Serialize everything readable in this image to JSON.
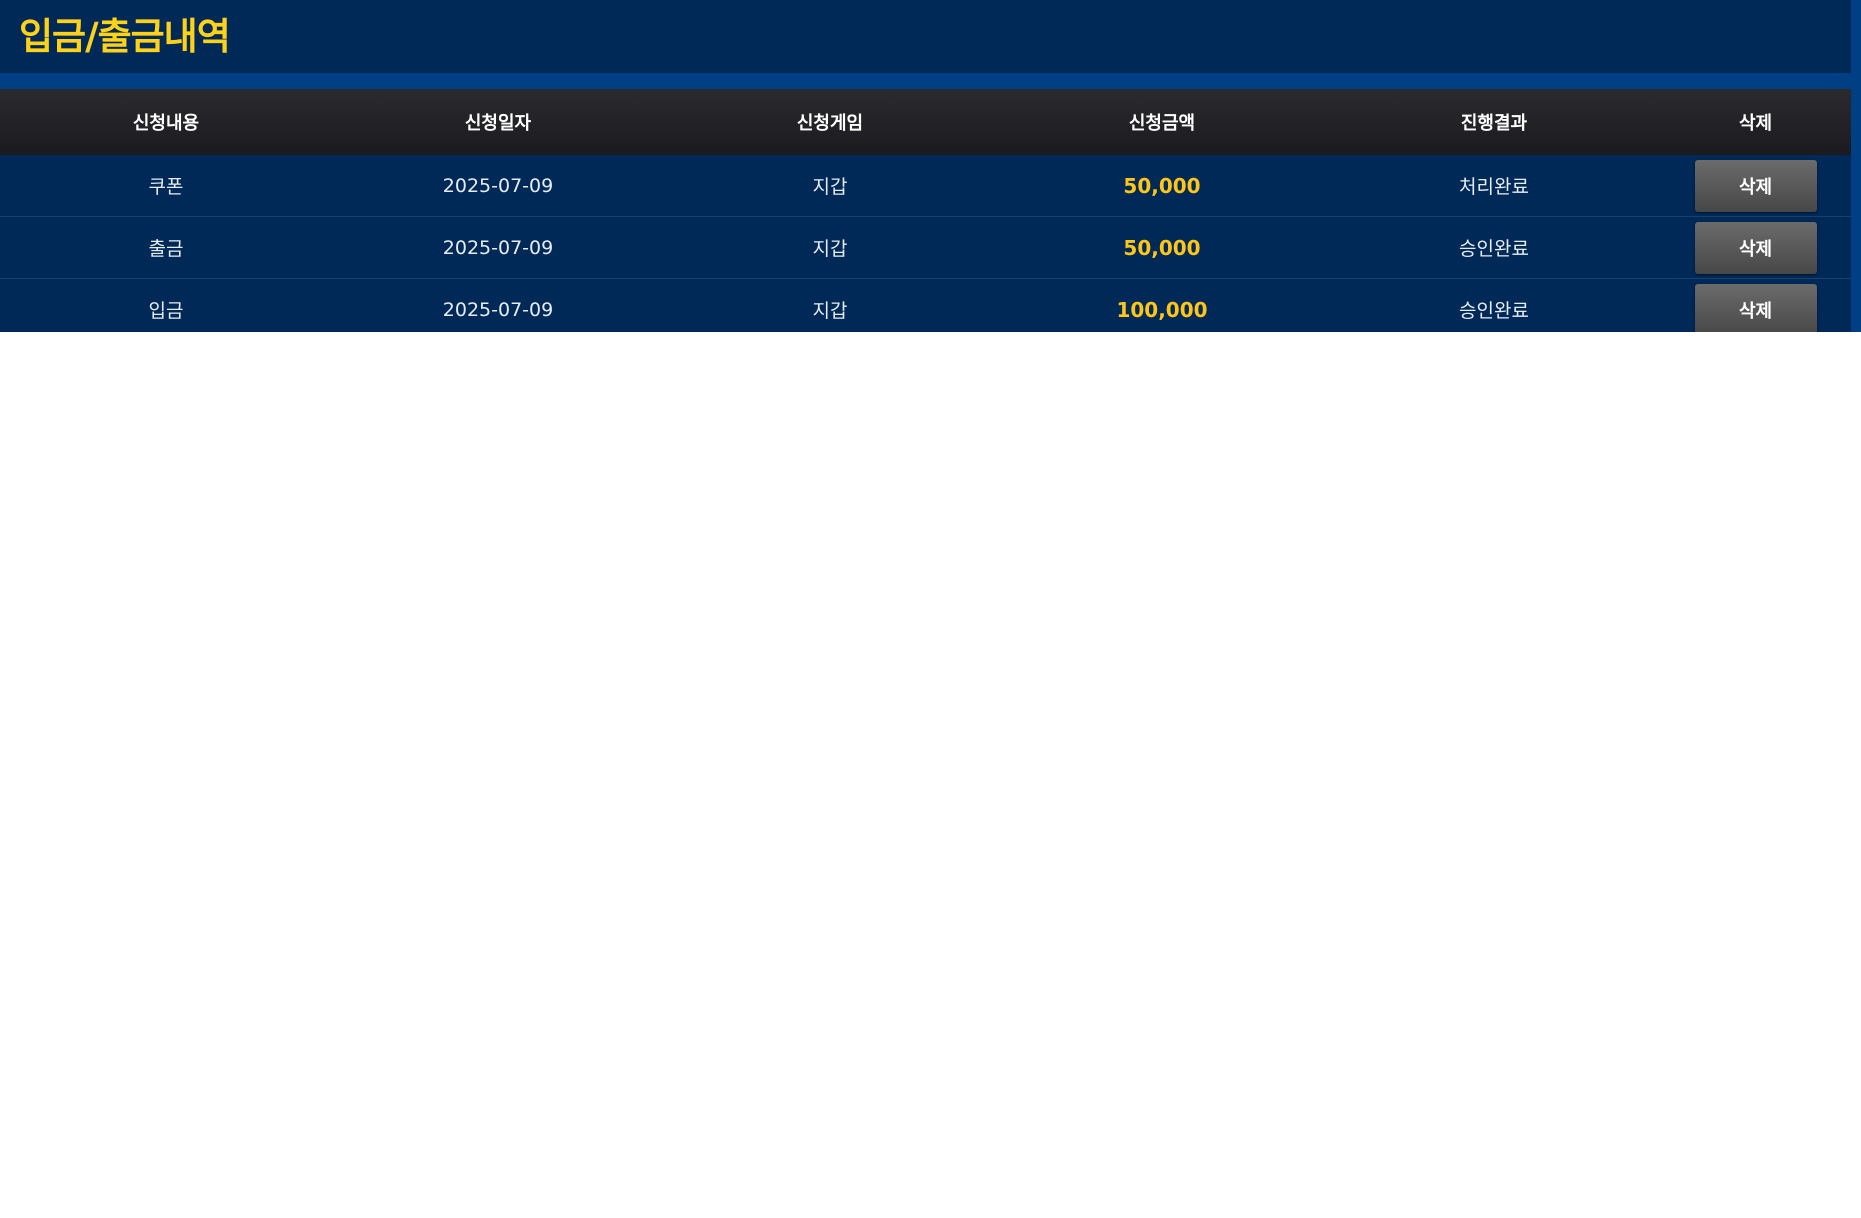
{
  "page": {
    "title": "입금/출금내역"
  },
  "table": {
    "headers": [
      "신청내용",
      "신청일자",
      "신청게임",
      "신청금액",
      "진행결과",
      "삭제"
    ],
    "rows": [
      {
        "type": "쿠폰",
        "date": "2025-07-09",
        "game": "지갑",
        "amount": "50,000",
        "status": "처리완료",
        "delete_label": "삭제"
      },
      {
        "type": "출금",
        "date": "2025-07-09",
        "game": "지갑",
        "amount": "50,000",
        "status": "승인완료",
        "delete_label": "삭제"
      },
      {
        "type": "입금",
        "date": "2025-07-09",
        "game": "지갑",
        "amount": "100,000",
        "status": "승인완료",
        "delete_label": "삭제"
      }
    ]
  },
  "colors": {
    "background": "#002957",
    "title": "#ffd21a",
    "amount": "#ffc61a",
    "header_bg": "#232327",
    "button": "#5a5a5a"
  }
}
